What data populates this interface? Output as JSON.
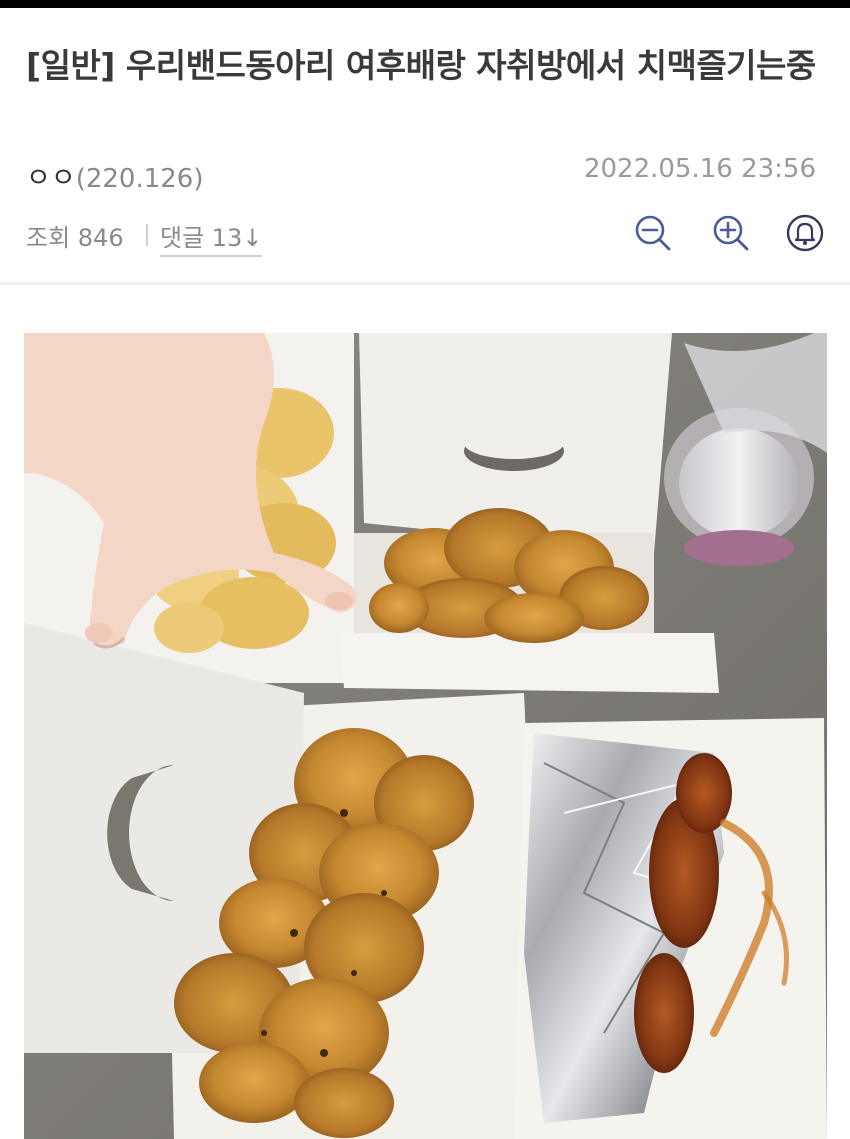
{
  "post": {
    "title": "[일반] 우리밴드동아리 여후배랑 자취방에서 치맥즐기는중",
    "author": "ㅇㅇ",
    "author_ip": "(220.126)",
    "date": "2022.05.16 23:56",
    "views_label": "조회 846",
    "comments_label": "댓글 13↓"
  },
  "icons": {
    "zoom_out": "zoom-out-icon",
    "zoom_in": "zoom-in-icon",
    "bell": "bell-icon"
  },
  "colors": {
    "text_primary": "#3a3a3a",
    "text_muted": "#8a8a8a",
    "icon_blue": "#4d5a9a"
  }
}
